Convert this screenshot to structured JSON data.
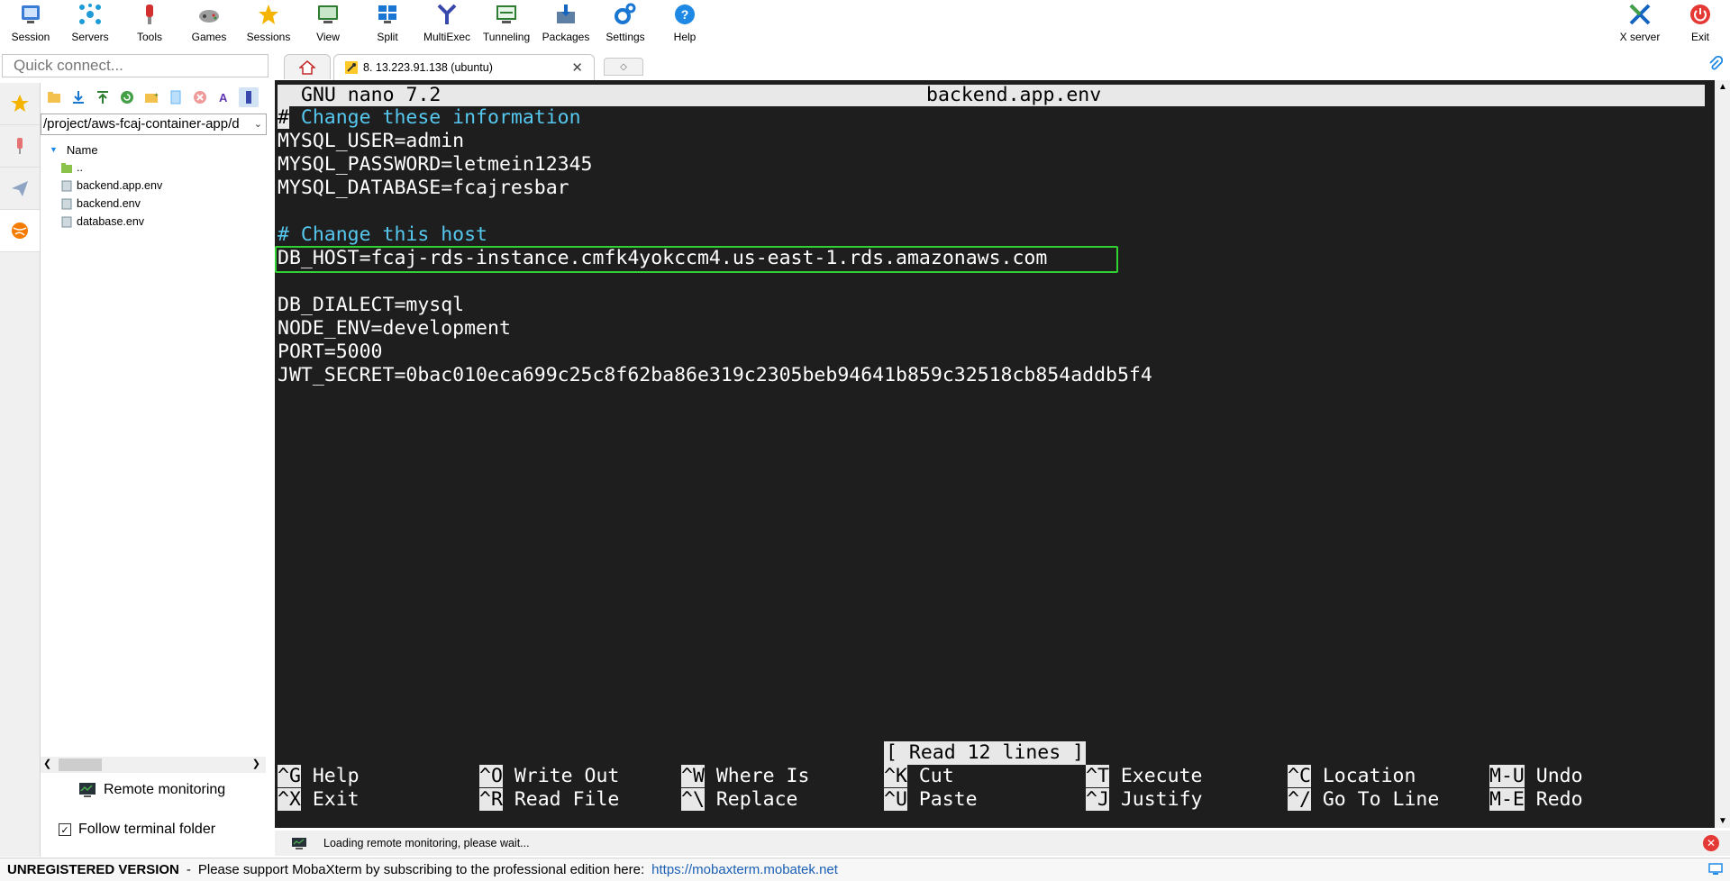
{
  "toolbar": {
    "left": [
      {
        "label": "Session",
        "icon": "session-icon"
      },
      {
        "label": "Servers",
        "icon": "servers-icon"
      },
      {
        "label": "Tools",
        "icon": "tools-icon"
      },
      {
        "label": "Games",
        "icon": "games-icon"
      },
      {
        "label": "Sessions",
        "icon": "sessions-star-icon"
      },
      {
        "label": "View",
        "icon": "view-icon"
      },
      {
        "label": "Split",
        "icon": "split-icon"
      },
      {
        "label": "MultiExec",
        "icon": "multiexec-icon"
      },
      {
        "label": "Tunneling",
        "icon": "tunneling-icon"
      },
      {
        "label": "Packages",
        "icon": "packages-icon"
      },
      {
        "label": "Settings",
        "icon": "settings-icon"
      },
      {
        "label": "Help",
        "icon": "help-icon"
      }
    ],
    "right": [
      {
        "label": "X server",
        "icon": "x-server-icon"
      },
      {
        "label": "Exit",
        "icon": "exit-icon"
      }
    ]
  },
  "quick_connect": {
    "placeholder": "Quick connect..."
  },
  "sftp": {
    "path": "/project/aws-fcaj-container-app/d",
    "column_header": "Name",
    "files": [
      "..",
      "backend.app.env",
      "backend.env",
      "database.env"
    ],
    "remote_monitoring_label": "Remote monitoring",
    "follow_terminal_label": "Follow terminal folder",
    "follow_checked": true
  },
  "session_tab": {
    "label": "8. 13.223.91.138 (ubuntu)"
  },
  "terminal": {
    "nano_version": "GNU nano 7.2",
    "file_name": "backend.app.env",
    "lines": [
      {
        "text": "# Change these information",
        "kind": "comment"
      },
      {
        "text": "MYSQL_USER=admin",
        "kind": "plain"
      },
      {
        "text": "MYSQL_PASSWORD=letmein12345",
        "kind": "plain"
      },
      {
        "text": "MYSQL_DATABASE=fcajresbar",
        "kind": "plain"
      },
      {
        "text": "",
        "kind": "plain"
      },
      {
        "text": "# Change this host",
        "kind": "comment"
      },
      {
        "text": "DB_HOST=fcaj-rds-instance.cmfk4yokccm4.us-east-1.rds.amazonaws.com",
        "kind": "highlight"
      },
      {
        "text": "",
        "kind": "plain"
      },
      {
        "text": "DB_DIALECT=mysql",
        "kind": "plain"
      },
      {
        "text": "NODE_ENV=development",
        "kind": "plain"
      },
      {
        "text": "PORT=5000",
        "kind": "plain"
      },
      {
        "text": "JWT_SECRET=0bac010eca699c25c8f62ba86e319c2305beb94641b859c32518cb854addb5f4",
        "kind": "plain"
      }
    ],
    "status_message": "[ Read 12 lines ]",
    "shortcuts_row1": [
      {
        "key": "^G",
        "label": "Help"
      },
      {
        "key": "^O",
        "label": "Write Out"
      },
      {
        "key": "^W",
        "label": "Where Is"
      },
      {
        "key": "^K",
        "label": "Cut"
      },
      {
        "key": "^T",
        "label": "Execute"
      },
      {
        "key": "^C",
        "label": "Location"
      },
      {
        "key": "M-U",
        "label": "Undo"
      }
    ],
    "shortcuts_row2": [
      {
        "key": "^X",
        "label": "Exit"
      },
      {
        "key": "^R",
        "label": "Read File"
      },
      {
        "key": "^\\",
        "label": "Replace"
      },
      {
        "key": "^U",
        "label": "Paste"
      },
      {
        "key": "^J",
        "label": "Justify"
      },
      {
        "key": "^/",
        "label": "Go To Line"
      },
      {
        "key": "M-E",
        "label": "Redo"
      }
    ]
  },
  "monitoring_status": "Loading remote monitoring, please wait...",
  "bottom_bar": {
    "unregistered": "UNREGISTERED VERSION",
    "separator": "-",
    "message": "Please support MobaXterm by subscribing to the professional edition here:",
    "link": "https://mobaxterm.mobatek.net"
  },
  "colors": {
    "terminal_bg": "#1e1e1e",
    "comment": "#56c8ef",
    "highlight_border": "#2fd22f",
    "link": "#1a5fb4"
  }
}
